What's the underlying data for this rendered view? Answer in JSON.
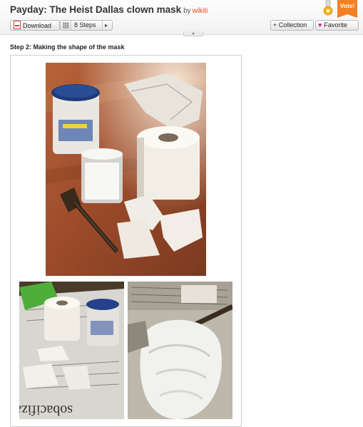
{
  "header": {
    "title": "Payday: The Heist Dallas clown mask",
    "by": "by",
    "author": "wikiti",
    "vote_label": "Vote!",
    "collapse_glyph": "▴"
  },
  "toolbar": {
    "download_label": "Download",
    "steps_label": "8 Steps",
    "next_glyph": "▸",
    "collection_label": "+ Collection",
    "favorite_label": "Favorite",
    "favorite_glyph": "♥"
  },
  "step": {
    "title": "Step 2: Making the shape of the mask"
  },
  "icons": {
    "pdf": "pdf-icon",
    "steps_grid": "grid-icon",
    "medal": "medal-icon",
    "heart": "heart-icon"
  },
  "colors": {
    "author": "#e6461a",
    "vote": "#f47f24",
    "heart": "#c61c8b"
  },
  "images": {
    "main": "photo-supplies",
    "thumb_left": "photo-newspaper-setup",
    "thumb_right": "photo-mask-shape"
  }
}
